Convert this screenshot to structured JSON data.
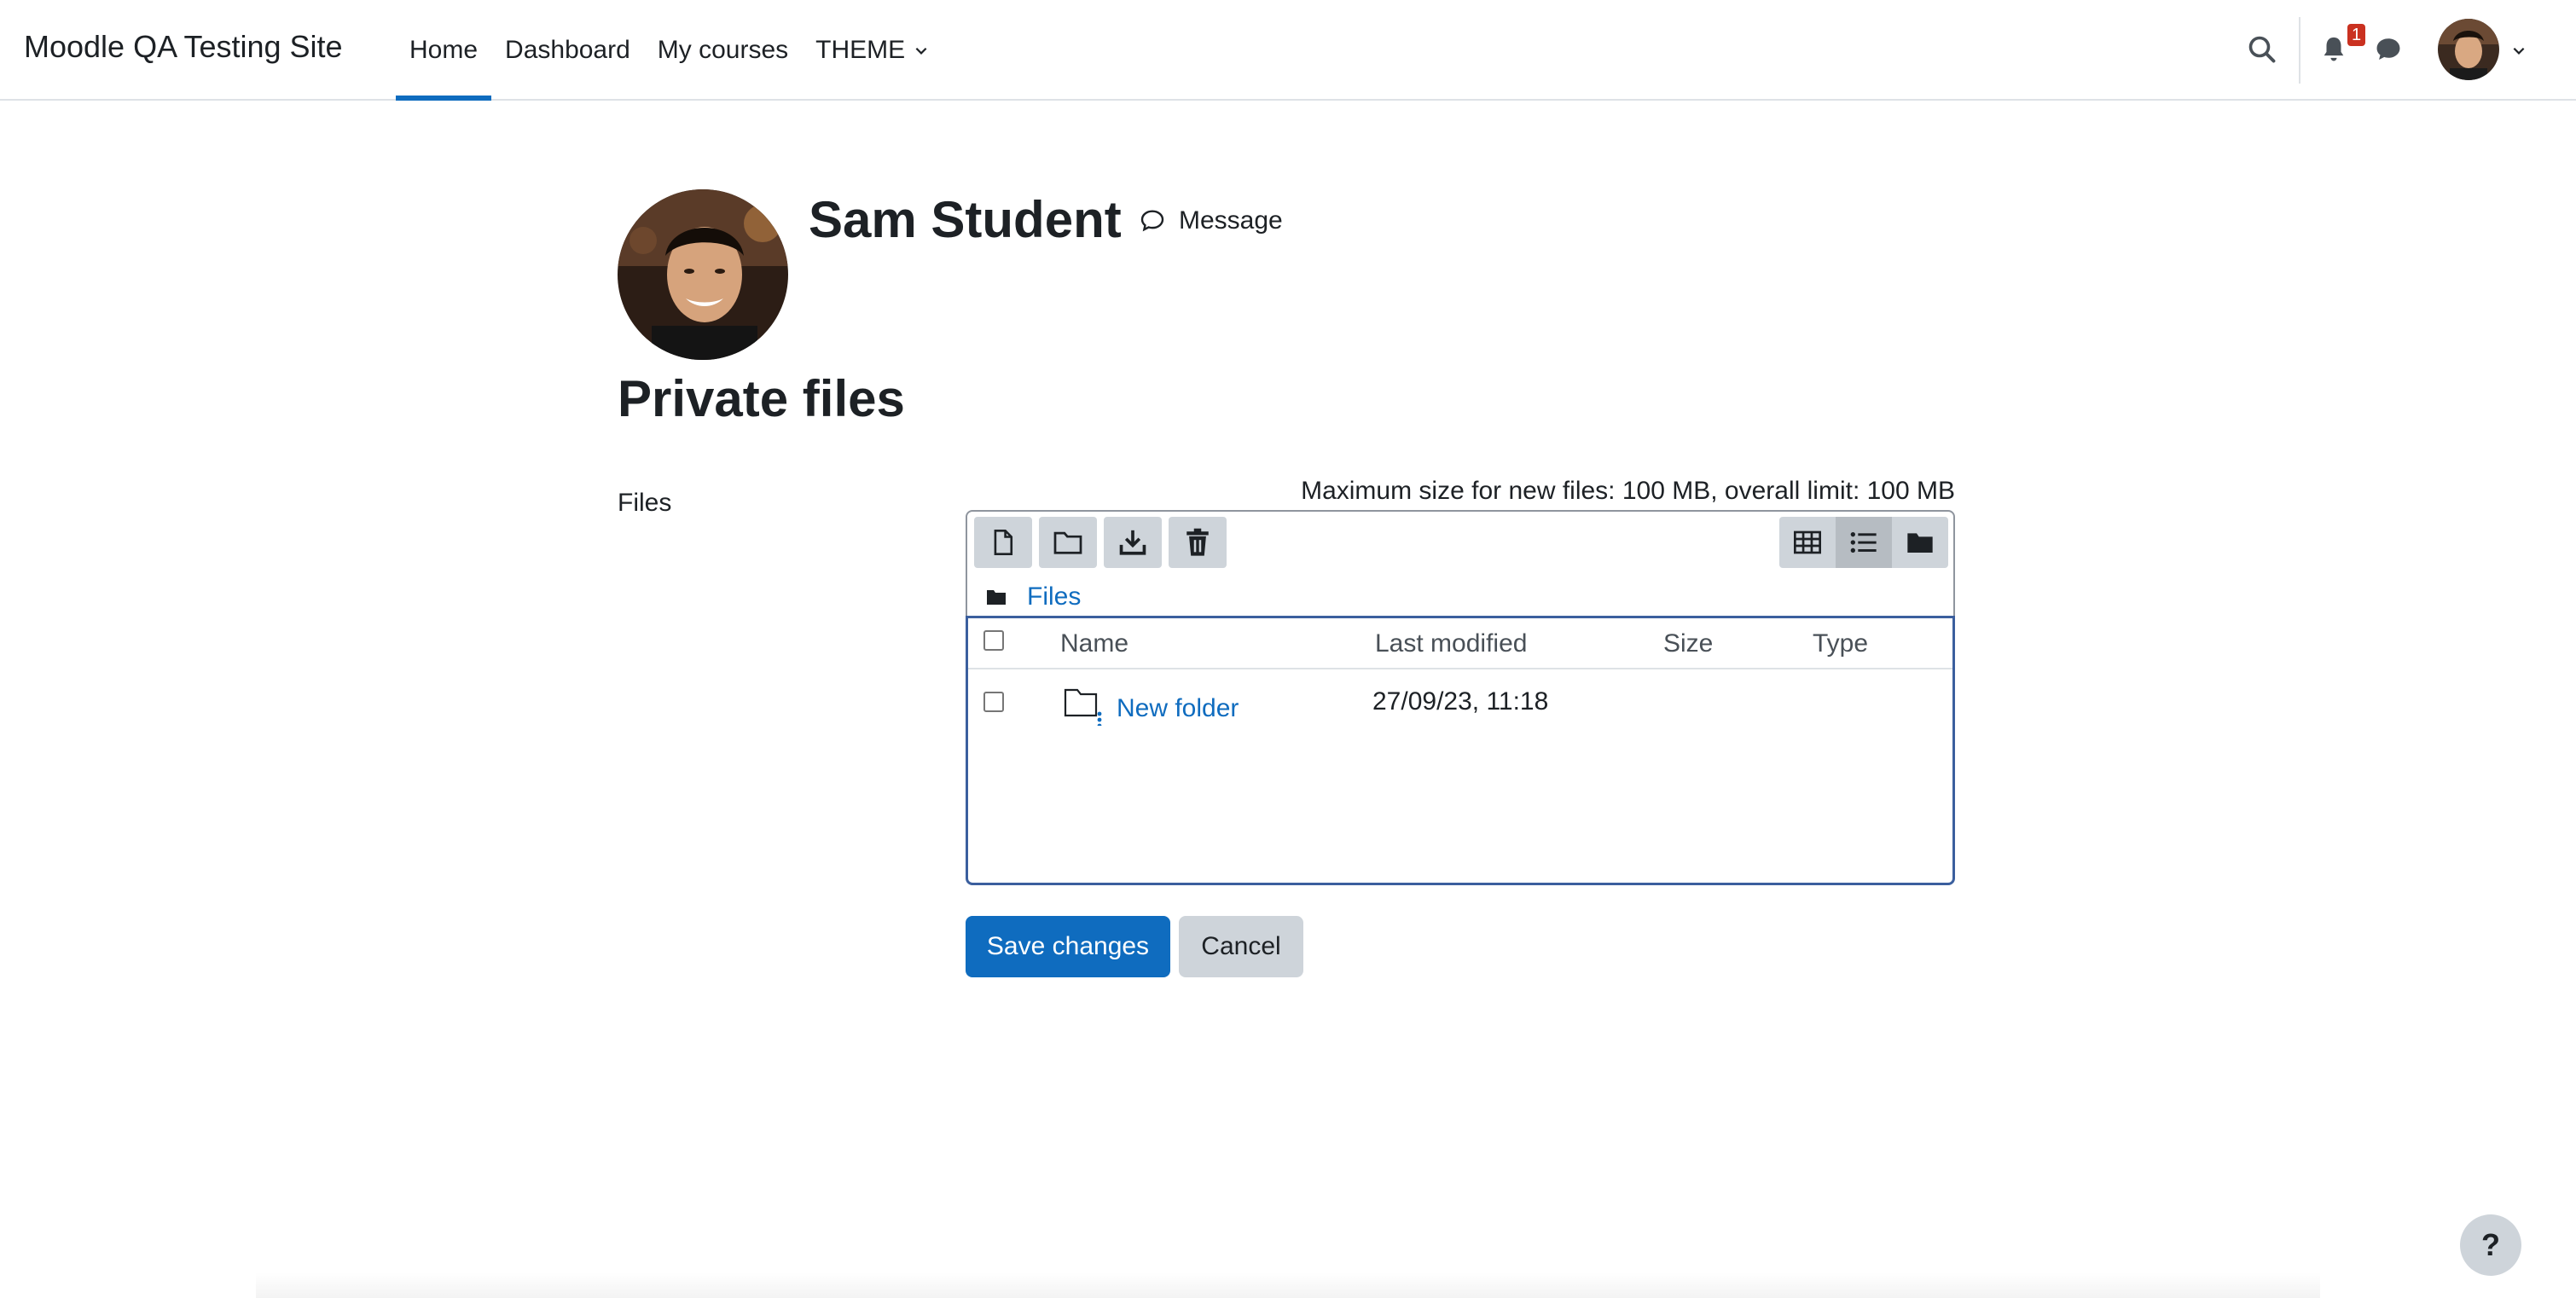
{
  "navbar": {
    "site_name": "Moodle QA Testing Site",
    "items": [
      {
        "label": "Home"
      },
      {
        "label": "Dashboard"
      },
      {
        "label": "My courses"
      },
      {
        "label": "THEME"
      }
    ],
    "notification_count": "1",
    "active_color": "#0f6cbf",
    "badge_color": "#ca3120"
  },
  "profile": {
    "name": "Sam Student",
    "message_label": "Message"
  },
  "page": {
    "title": "Private files"
  },
  "form": {
    "files_label": "Files",
    "max_size_text": "Maximum size for new files: 100 MB, overall limit: 100 MB",
    "path_label": "Files",
    "columns": [
      "Name",
      "Last modified",
      "Size",
      "Type"
    ],
    "rows": [
      {
        "name": "New folder",
        "last_modified": "27/09/23, 11:18",
        "size": "",
        "type": ""
      }
    ],
    "save_label": "Save changes",
    "cancel_label": "Cancel",
    "primary_color": "#0f6cbf"
  },
  "help": {
    "label": "?"
  }
}
